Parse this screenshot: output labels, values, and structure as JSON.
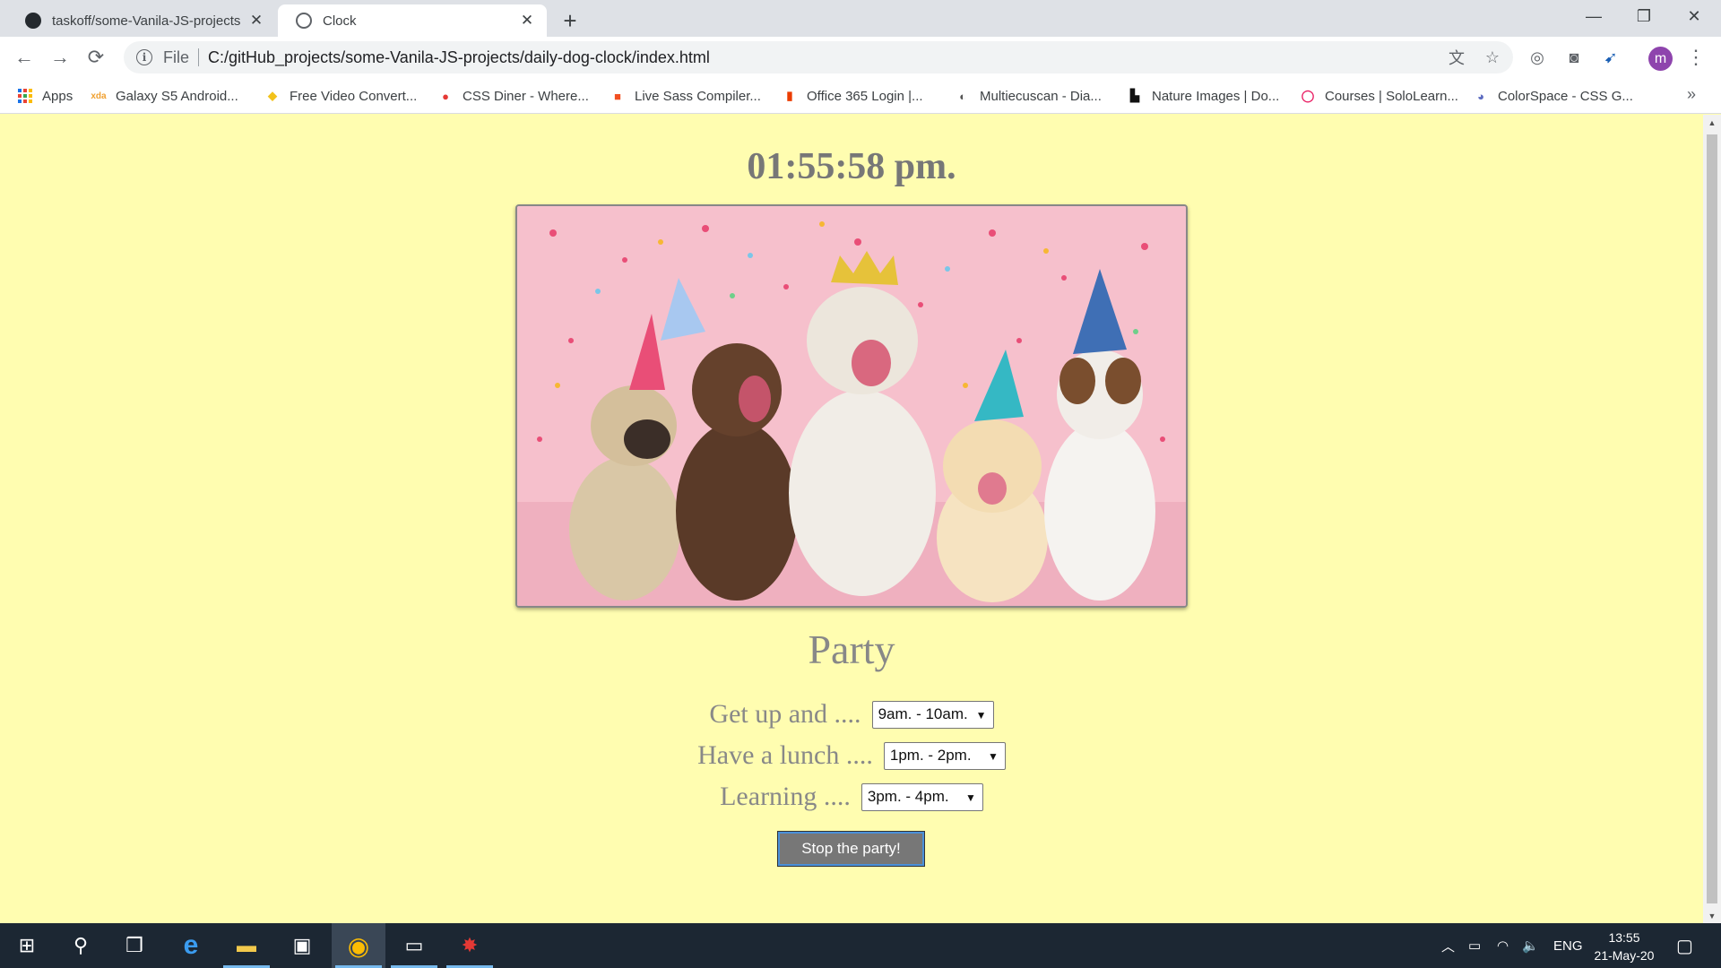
{
  "browser": {
    "tabs": [
      {
        "title": "taskoff/some-Vanila-JS-projects",
        "close": "✕",
        "icon": "github-icon"
      },
      {
        "title": "Clock",
        "close": "✕",
        "icon": "globe-icon"
      }
    ],
    "new_tab": "+",
    "window": {
      "minimize": "—",
      "maximize": "❐",
      "close": "✕"
    },
    "nav": {
      "back": "←",
      "forward": "→",
      "reload": "⟳"
    },
    "address": {
      "info": "i",
      "scheme": "File",
      "url": "C:/gitHub_projects/some-Vanila-JS-projects/daily-dog-clock/index.html"
    },
    "toolbar_icons": {
      "translate": "文",
      "bookmark": "☆",
      "ext1": "◎",
      "camera": "◙",
      "ext2": "➹",
      "menu": "⋮"
    },
    "profile_initial": "m",
    "bookmarks": [
      {
        "label": "Apps"
      },
      {
        "label": "Galaxy S5 Android...",
        "glyph": "xda",
        "color": "#f0a030"
      },
      {
        "label": "Free Video Convert...",
        "glyph": "◆",
        "color": "#f2c21b"
      },
      {
        "label": "CSS Diner - Where...",
        "glyph": "●",
        "color": "#e53935"
      },
      {
        "label": "Live Sass Compiler...",
        "glyph": "■",
        "color": "#f25022"
      },
      {
        "label": "Office 365 Login |...",
        "glyph": "▮",
        "color": "#eb3c00"
      },
      {
        "label": "Multiecuscan - Dia...",
        "glyph": "◐",
        "color": "#555555"
      },
      {
        "label": "Nature Images | Do...",
        "glyph": "▙",
        "color": "#111111"
      },
      {
        "label": "Courses | SoloLearn...",
        "glyph": "◯",
        "color": "#e91e63"
      },
      {
        "label": "ColorSpace - CSS G...",
        "glyph": "◕",
        "color": "#5c6bc0"
      }
    ],
    "bookmarks_more": "»"
  },
  "page": {
    "clock": "01:55:58 pm.",
    "image_alt": "party dogs",
    "activity": "Party",
    "rows": [
      {
        "label": "Get up and ....",
        "value": "9am. - 10am."
      },
      {
        "label": "Have a lunch ....",
        "value": "1pm. - 2pm."
      },
      {
        "label": "Learning ....",
        "value": "3pm. - 4pm."
      }
    ],
    "select_arrow": "▼",
    "stop_button": "Stop the party!",
    "scroll_up": "▲",
    "scroll_down": "▼"
  },
  "taskbar": {
    "start": "⊞",
    "search": "⚲",
    "taskview": "❒",
    "edge": "e",
    "explorer": "▬",
    "store": "▣",
    "chrome": "◉",
    "terminal": "▭",
    "app": "✸",
    "tray_up": "︿",
    "battery": "▭",
    "wifi": "◠",
    "volume": "🔈",
    "language": "ENG",
    "time": "13:55",
    "date": "21-May-20",
    "notifications": "▢"
  },
  "colors": {
    "page_bg": "#fffdb0",
    "text_gray": "#888888",
    "button_bg": "#777777",
    "photo_bg": "#f6c0cc",
    "taskbar_bg": "#1c2733"
  }
}
